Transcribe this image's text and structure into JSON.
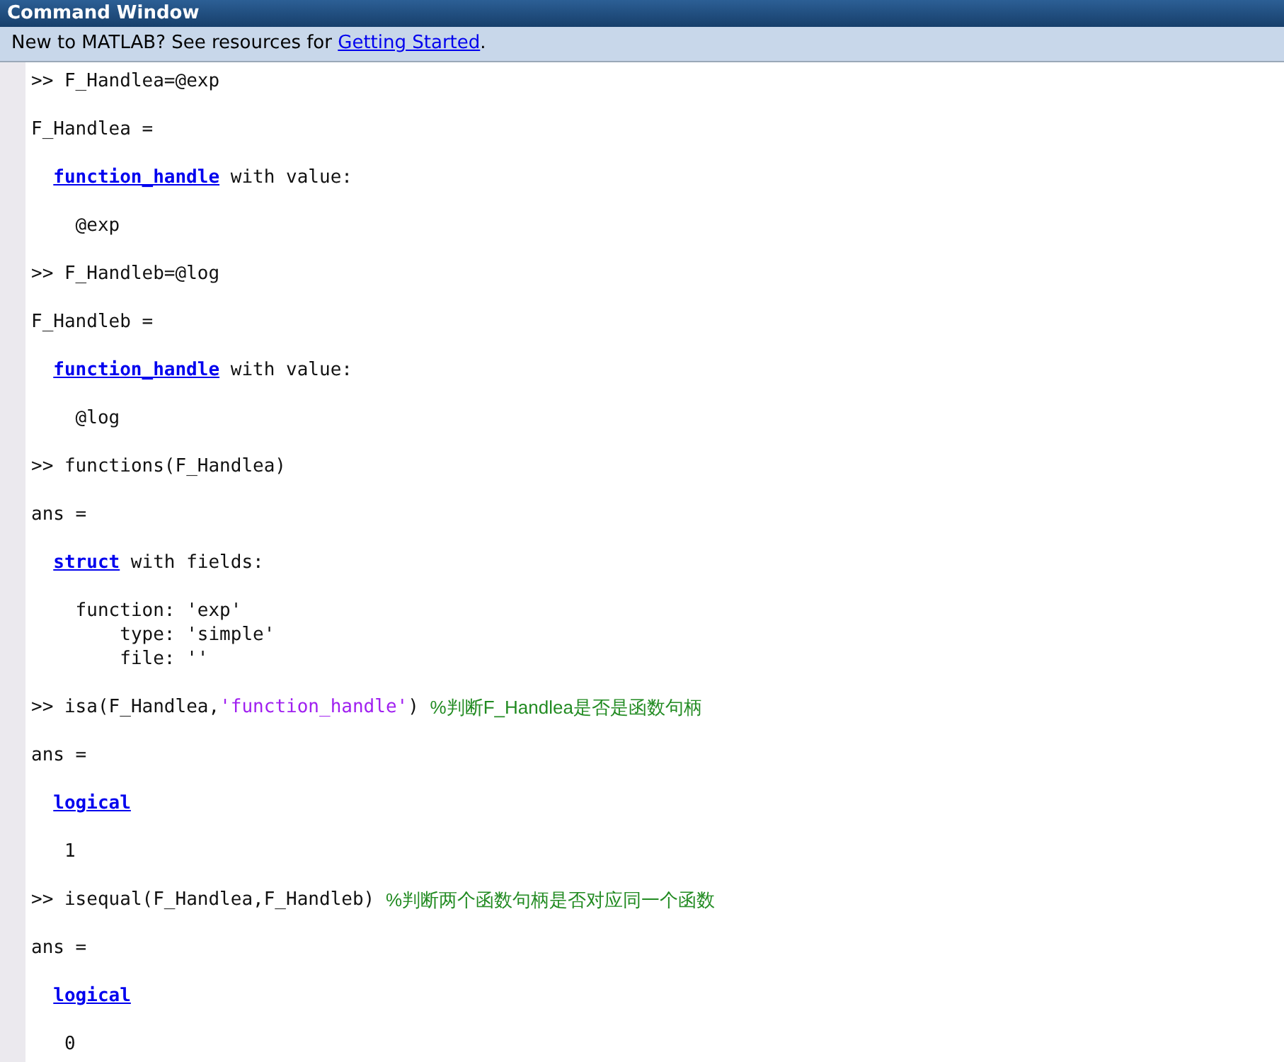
{
  "window": {
    "title": "Command Window"
  },
  "info_bar": {
    "text": "New to MATLAB? See resources for ",
    "link": "Getting Started",
    "after": "."
  },
  "blocks": [
    [
      [
        {
          "kind": "prompt",
          "text": ">> F_Handlea=@exp"
        }
      ]
    ],
    [
      [
        {
          "kind": "plain",
          "text": "F_Handlea ="
        }
      ]
    ],
    [
      [
        {
          "kind": "link",
          "text": "function_handle"
        },
        {
          "kind": "plain",
          "text": " with value:"
        }
      ]
    ],
    [
      [
        {
          "kind": "plain",
          "text": "    @exp"
        }
      ]
    ],
    [
      [
        {
          "kind": "prompt",
          "text": ">> F_Handleb=@log"
        }
      ]
    ],
    [
      [
        {
          "kind": "plain",
          "text": "F_Handleb ="
        }
      ]
    ],
    [
      [
        {
          "kind": "link",
          "text": "function_handle"
        },
        {
          "kind": "plain",
          "text": " with value:"
        }
      ]
    ],
    [
      [
        {
          "kind": "plain",
          "text": "    @log"
        }
      ]
    ],
    [
      [
        {
          "kind": "prompt",
          "text": ">> functions(F_Handlea)"
        }
      ]
    ],
    [
      [
        {
          "kind": "plain",
          "text": "ans ="
        }
      ]
    ],
    [
      [
        {
          "kind": "link",
          "text": "struct"
        },
        {
          "kind": "plain",
          "text": " with fields:"
        }
      ]
    ],
    [
      [
        {
          "kind": "plain",
          "text": "    function: 'exp'"
        }
      ],
      [
        {
          "kind": "plain",
          "text": "        type: 'simple'"
        }
      ],
      [
        {
          "kind": "plain",
          "text": "        file: ''"
        }
      ]
    ],
    [
      [
        {
          "kind": "prompt",
          "text": ">> isa(F_Handlea,"
        },
        {
          "kind": "string",
          "text": "'function_handle'"
        },
        {
          "kind": "plain",
          "text": ") "
        },
        {
          "kind": "comment",
          "text": "%判断F_Handlea是否是函数句柄"
        }
      ]
    ],
    [
      [
        {
          "kind": "plain",
          "text": "ans ="
        }
      ]
    ],
    [
      [
        {
          "kind": "link",
          "text": "logical"
        }
      ]
    ],
    [
      [
        {
          "kind": "plain",
          "text": "   1"
        }
      ]
    ],
    [
      [
        {
          "kind": "prompt",
          "text": ">> isequal(F_Handlea,F_Handleb) "
        },
        {
          "kind": "comment",
          "text": "%判断两个函数句柄是否对应同一个函数"
        }
      ]
    ],
    [
      [
        {
          "kind": "plain",
          "text": "ans ="
        }
      ]
    ],
    [
      [
        {
          "kind": "link",
          "text": "logical"
        }
      ]
    ],
    [
      [
        {
          "kind": "plain",
          "text": "   0"
        }
      ]
    ]
  ]
}
